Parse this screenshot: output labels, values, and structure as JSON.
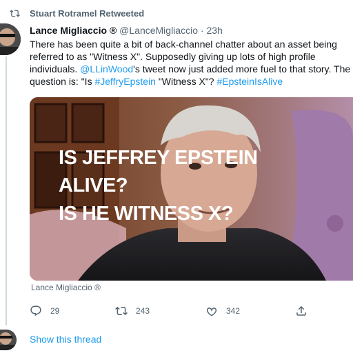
{
  "retweet_banner": {
    "text": "Stuart Rotramel Retweeted",
    "icon": "retweet-icon"
  },
  "tweet": {
    "display_name": "Lance Migliaccio",
    "verified_mark": "®",
    "handle": "@LanceMigliaccio",
    "separator": "·",
    "time": "23h",
    "text": {
      "line1": "There has been quite a bit of back-channel chatter about an asset being",
      "line2": "referred to as \"Witness X\". Supposedly giving up lots of high profile",
      "line3_prefix": "individuals. ",
      "line3_mention": "@LLinWood",
      "line3_suffix": "'s tweet now just added more fuel to that story. The",
      "line4_prefix": "question is: \"Is ",
      "line4_hashtag1": "#JeffryEpstein",
      "line4_middle": " \"Witness X\"? ",
      "line4_hashtag2": "#EpsteinIsAlive"
    },
    "media": {
      "overlay_line1": "IS JEFFREY EPSTEIN",
      "overlay_line2": "ALIVE?",
      "overlay_line3": "IS HE WITNESS X?",
      "caption": "Lance Migliaccio ®"
    },
    "actions": {
      "reply_count": "29",
      "retweet_count": "243",
      "like_count": "342"
    },
    "show_thread": "Show this thread"
  }
}
